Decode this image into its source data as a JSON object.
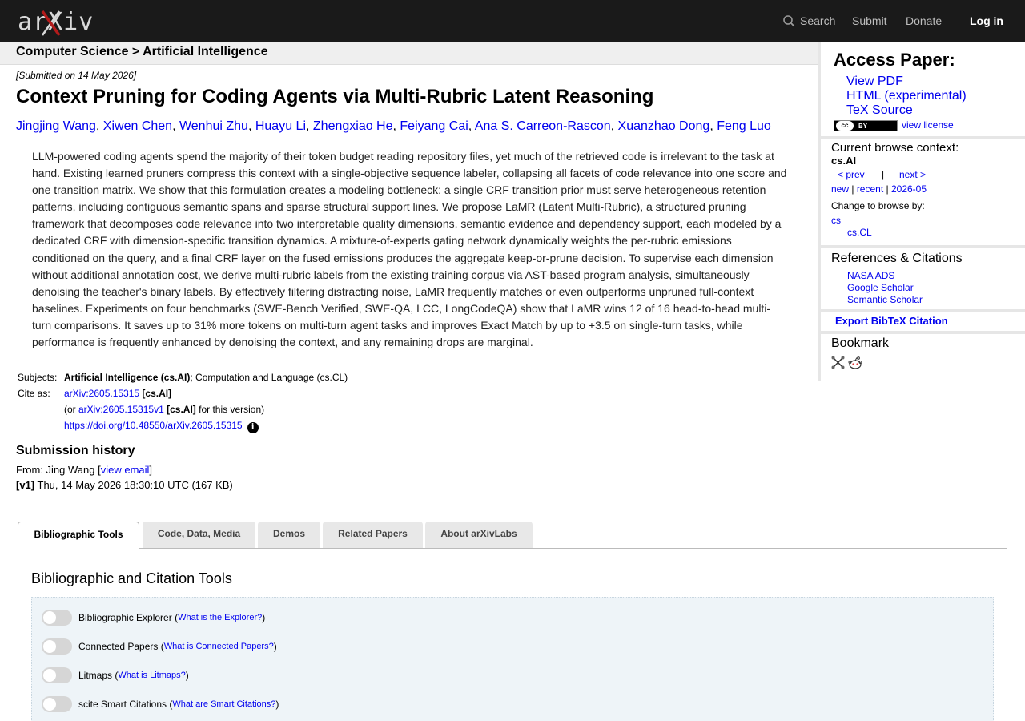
{
  "header": {
    "logo_text": "arXiv",
    "nav": {
      "search": "Search",
      "submit": "Submit",
      "donate": "Donate",
      "login": "Log in"
    }
  },
  "breadcrumb": "Computer Science > Artificial Intelligence",
  "paper": {
    "submitted": "[Submitted on 14 May 2026]",
    "title": "Context Pruning for Coding Agents via Multi-Rubric Latent Reasoning",
    "authors": [
      "Jingjing Wang",
      "Xiwen Chen",
      "Wenhui Zhu",
      "Huayu Li",
      "Zhengxiao He",
      "Feiyang Cai",
      "Ana S. Carreon-Rascon",
      "Xuanzhao Dong",
      "Feng Luo"
    ],
    "abstract": "LLM-powered coding agents spend the majority of their token budget reading repository files, yet much of the retrieved code is irrelevant to the task at hand. Existing learned pruners compress this context with a single-objective sequence labeler, collapsing all facets of code relevance into one score and one transition matrix. We show that this formulation creates a modeling bottleneck: a single CRF transition prior must serve heterogeneous retention patterns, including contiguous semantic spans and sparse structural support lines. We propose LaMR (Latent Multi-Rubric), a structured pruning framework that decomposes code relevance into two interpretable quality dimensions, semantic evidence and dependency support, each modeled by a dedicated CRF with dimension-specific transition dynamics. A mixture-of-experts gating network dynamically weights the per-rubric emissions conditioned on the query, and a final CRF layer on the fused emissions produces the aggregate keep-or-prune decision. To supervise each dimension without additional annotation cost, we derive multi-rubric labels from the existing training corpus via AST-based program analysis, simultaneously denoising the teacher's binary labels. By effectively filtering distracting noise, LaMR frequently matches or even outperforms unpruned full-context baselines. Experiments on four benchmarks (SWE-Bench Verified, SWE-QA, LCC, LongCodeQA) show that LaMR wins 12 of 16 head-to-head multi-turn comparisons. It saves up to 31% more tokens on multi-turn agent tasks and improves Exact Match by up to +3.5 on single-turn tasks, while performance is frequently enhanced by denoising the context, and any remaining drops are marginal.",
    "subjects_label": "Subjects:",
    "subject_primary": "Artificial Intelligence (cs.AI)",
    "subject_rest": "; Computation and Language (cs.CL)",
    "cite_label": "Cite as:",
    "cite_id": "arXiv:2605.15315",
    "cite_cat": "[cs.AI]",
    "cite_or_prefix": "(or ",
    "cite_version_id": "arXiv:2605.15315v1",
    "cite_version_cat": "[cs.AI]",
    "cite_version_suffix": " for this version)",
    "doi": "https://doi.org/10.48550/arXiv.2605.15315"
  },
  "history": {
    "heading": "Submission history",
    "from_prefix": "From: Jing Wang [",
    "view_email": "view email",
    "from_suffix": "]",
    "v1_label": "[v1]",
    "v1_text": " Thu, 14 May 2026 18:30:10 UTC (167 KB)"
  },
  "tabs": [
    "Bibliographic Tools",
    "Code, Data, Media",
    "Demos",
    "Related Papers",
    "About arXivLabs"
  ],
  "tools": {
    "heading": "Bibliographic and Citation Tools",
    "items": [
      {
        "label": "Bibliographic Explorer",
        "link": "What is the Explorer?"
      },
      {
        "label": "Connected Papers",
        "link": "What is Connected Papers?"
      },
      {
        "label": "Litmaps",
        "link": "What is Litmaps?"
      },
      {
        "label": "scite Smart Citations",
        "link": "What are Smart Citations?"
      }
    ]
  },
  "sidebar": {
    "access_heading": "Access Paper:",
    "access_links": [
      "View PDF",
      "HTML (experimental)",
      "TeX Source"
    ],
    "license_badge": "BY",
    "license_cc": "cc",
    "view_license": "view license",
    "context_heading": "Current browse context:",
    "context_value": "cs.AI",
    "prev": "< prev",
    "sep": "|",
    "next": "next >",
    "new": "new",
    "recent": "recent",
    "month": "2026-05",
    "change_heading": "Change to browse by:",
    "browse_cs": "cs",
    "browse_cscl": "cs.CL",
    "refs_heading": "References & Citations",
    "refs": [
      "NASA ADS",
      "Google Scholar",
      "Semantic Scholar"
    ],
    "bibtex": "Export BibTeX Citation",
    "bookmark_heading": "Bookmark"
  },
  "colors": {
    "header_bg": "#1a1a1a",
    "link": "#0000ee",
    "logo_x": "#b31b1b",
    "tool_bg": "#eef4f8"
  }
}
